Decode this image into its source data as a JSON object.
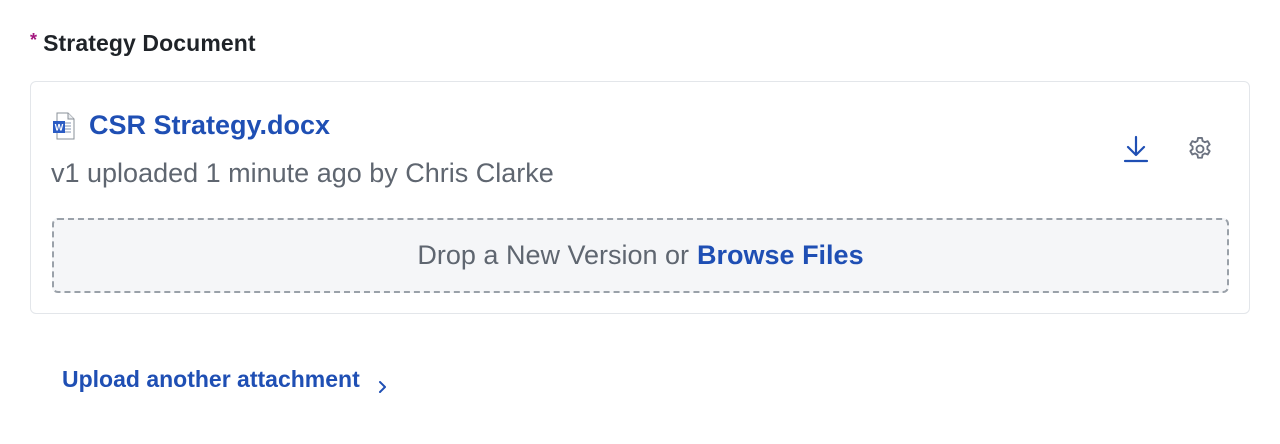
{
  "field": {
    "required_marker": "*",
    "label": "Strategy Document"
  },
  "attachment": {
    "file_icon": "word-document-icon",
    "file_name": "CSR Strategy.docx",
    "meta": "v1 uploaded 1 minute ago by Chris Clarke",
    "actions": {
      "download_icon": "download-icon",
      "settings_icon": "gear-icon"
    }
  },
  "dropzone": {
    "prompt": "Drop a New Version or",
    "browse_label": "Browse Files"
  },
  "upload_another": {
    "label": "Upload another attachment",
    "icon": "chevron-right-icon"
  },
  "colors": {
    "link": "#1f4fb4",
    "required": "#a3167e",
    "muted_text": "#5f6670",
    "dropzone_bg": "#f5f6f8"
  }
}
